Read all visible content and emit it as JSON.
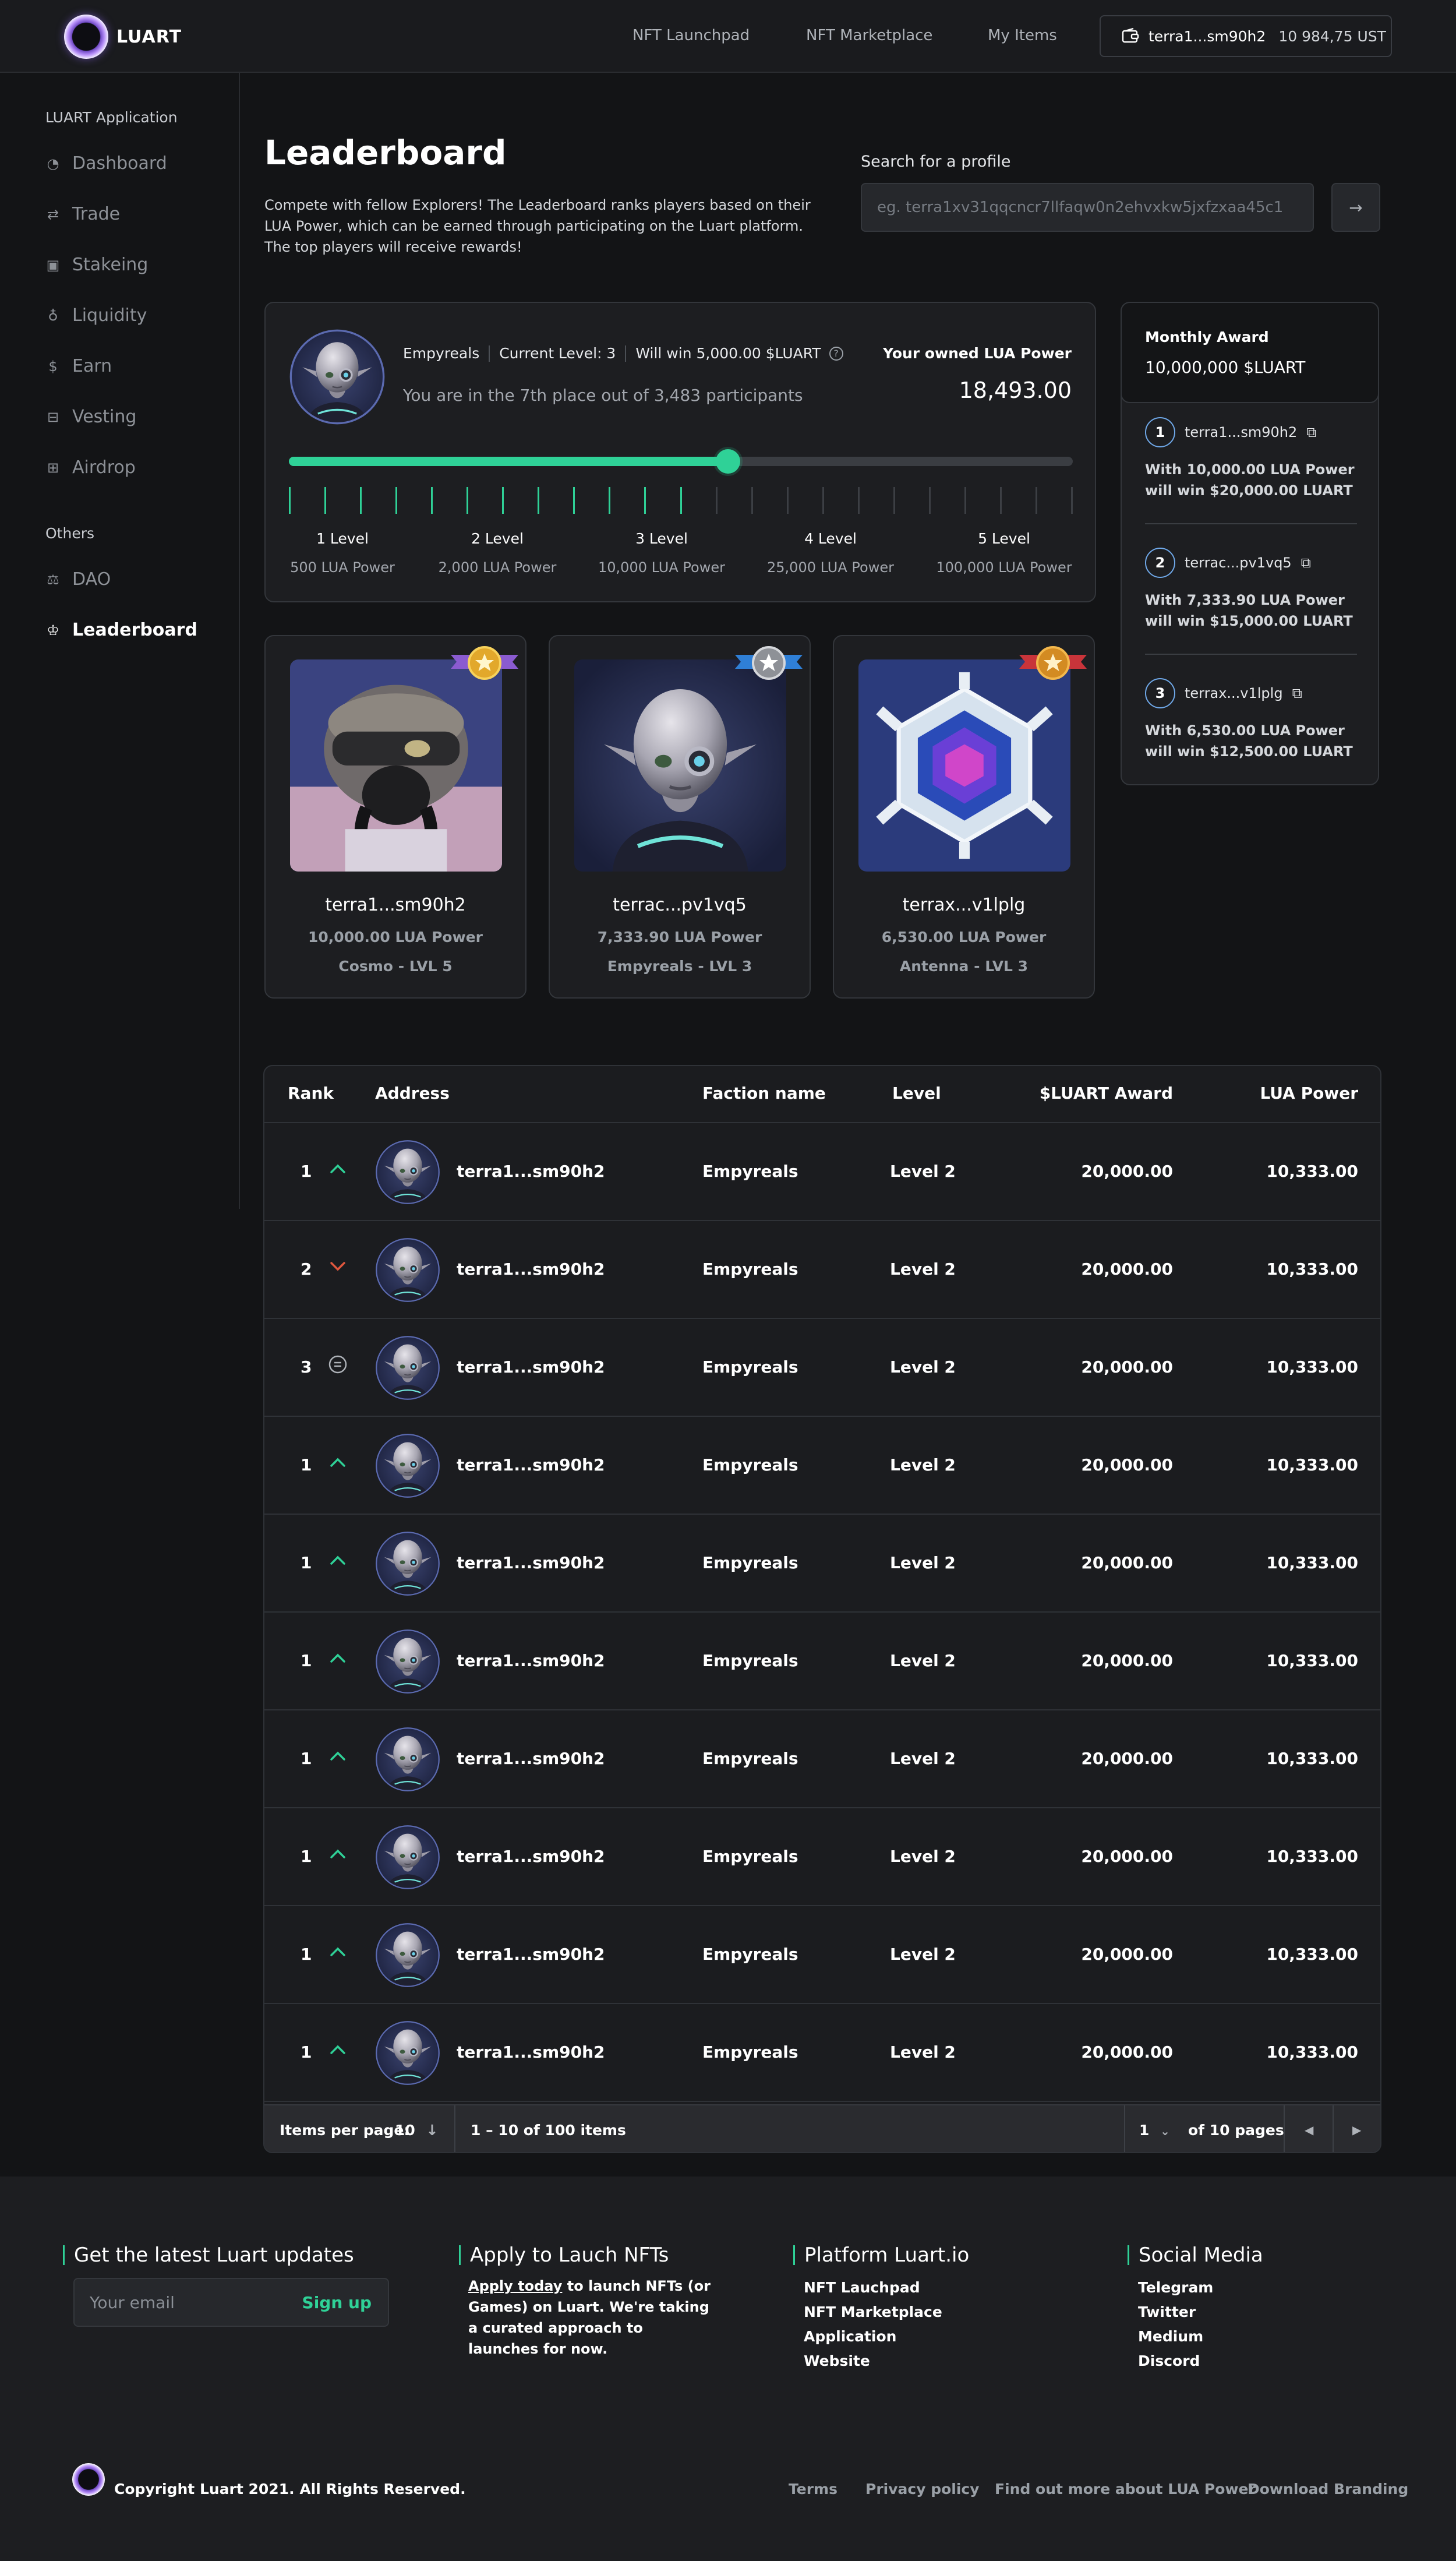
{
  "brand": {
    "name": "LUART"
  },
  "topnav": {
    "links": [
      "NFT Launchpad",
      "NFT Marketplace",
      "My Items"
    ],
    "wallet_address": "terra1...sm90h2",
    "wallet_balance": "10 984,75 UST"
  },
  "sidebar": {
    "section1": "LUART Application",
    "items1": [
      {
        "label": "Dashboard",
        "icon": "gauge-icon"
      },
      {
        "label": "Trade",
        "icon": "swap-icon"
      },
      {
        "label": "Stakeing",
        "icon": "stake-icon"
      },
      {
        "label": "Liquidity",
        "icon": "liquidity-icon"
      },
      {
        "label": "Earn",
        "icon": "dollar-icon"
      },
      {
        "label": "Vesting",
        "icon": "vesting-icon"
      },
      {
        "label": "Airdrop",
        "icon": "gift-icon"
      }
    ],
    "section2": "Others",
    "items2": [
      {
        "label": "DAO",
        "icon": "scale-icon"
      },
      {
        "label": "Leaderboard",
        "icon": "trophy-icon",
        "active": true
      }
    ]
  },
  "hero": {
    "title": "Leaderboard",
    "intro": "Compete with fellow Explorers! The Leaderboard ranks players based on their LUA Power, which can be earned through participating on the Luart platform. The top players will receive rewards!",
    "search_label": "Search for a profile",
    "search_placeholder": "eg. terra1xv31qqcncr7llfaqw0n2ehvxkw5jxfzxaa45c1"
  },
  "level_card": {
    "faction": "Empyreals",
    "current_level": "Current Level: 3",
    "will_win": "Will win 5,000.00 $LUART",
    "place_text": "You are in the 7th place out of 3,483 participants",
    "owned_label": "Your owned LUA Power",
    "owned_value": "18,493.00",
    "progress": 0.56,
    "ticks_total": 23,
    "ticks_active": 12,
    "levels": [
      {
        "name": "1 Level",
        "power": "500 LUA Power"
      },
      {
        "name": "2 Level",
        "power": "2,000 LUA Power"
      },
      {
        "name": "3 Level",
        "power": "10,000 LUA Power"
      },
      {
        "name": "4 Level",
        "power": "25,000 LUA Power"
      },
      {
        "name": "5 Level",
        "power": "100,000 LUA Power"
      }
    ]
  },
  "monthly_award": {
    "title": "Monthly Award",
    "value": "10,000,000 $LUART",
    "entries": [
      {
        "rank": "1",
        "address": "terra1...sm90h2",
        "line1": "With 10,000.00 LUA Power",
        "line2": "will win $20,000.00 LUART"
      },
      {
        "rank": "2",
        "address": "terrac...pv1vq5",
        "line1": "With 7,333.90 LUA Power",
        "line2": "will win $15,000.00 LUART"
      },
      {
        "rank": "3",
        "address": "terrax...v1lplg",
        "line1": "With 6,530.00 LUA Power",
        "line2": "will win $12,500.00 LUART"
      }
    ]
  },
  "top_players": [
    {
      "address": "terra1...sm90h2",
      "power": "10,000.00 LUA Power",
      "faction": "Cosmo - LVL 5",
      "medal": "gold"
    },
    {
      "address": "terrac...pv1vq5",
      "power": "7,333.90 LUA Power",
      "faction": "Empyreals - LVL 3",
      "medal": "silver"
    },
    {
      "address": "terrax...v1lplg",
      "power": "6,530.00 LUA Power",
      "faction": "Antenna - LVL 3",
      "medal": "bronze"
    }
  ],
  "table": {
    "headers": [
      "Rank",
      "Address",
      "Faction name",
      "Level",
      "$LUART Award",
      "LUA Power"
    ],
    "rows": [
      {
        "rank": "1",
        "trend": "up",
        "address": "terra1...sm90h2",
        "faction": "Empyreals",
        "level": "Level 2",
        "award": "20,000.00",
        "power": "10,333.00"
      },
      {
        "rank": "2",
        "trend": "down",
        "address": "terra1...sm90h2",
        "faction": "Empyreals",
        "level": "Level 2",
        "award": "20,000.00",
        "power": "10,333.00"
      },
      {
        "rank": "3",
        "trend": "same",
        "address": "terra1...sm90h2",
        "faction": "Empyreals",
        "level": "Level 2",
        "award": "20,000.00",
        "power": "10,333.00"
      },
      {
        "rank": "1",
        "trend": "up",
        "address": "terra1...sm90h2",
        "faction": "Empyreals",
        "level": "Level 2",
        "award": "20,000.00",
        "power": "10,333.00"
      },
      {
        "rank": "1",
        "trend": "up",
        "address": "terra1...sm90h2",
        "faction": "Empyreals",
        "level": "Level 2",
        "award": "20,000.00",
        "power": "10,333.00"
      },
      {
        "rank": "1",
        "trend": "up",
        "address": "terra1...sm90h2",
        "faction": "Empyreals",
        "level": "Level 2",
        "award": "20,000.00",
        "power": "10,333.00"
      },
      {
        "rank": "1",
        "trend": "up",
        "address": "terra1...sm90h2",
        "faction": "Empyreals",
        "level": "Level 2",
        "award": "20,000.00",
        "power": "10,333.00"
      },
      {
        "rank": "1",
        "trend": "up",
        "address": "terra1...sm90h2",
        "faction": "Empyreals",
        "level": "Level 2",
        "award": "20,000.00",
        "power": "10,333.00"
      },
      {
        "rank": "1",
        "trend": "up",
        "address": "terra1...sm90h2",
        "faction": "Empyreals",
        "level": "Level 2",
        "award": "20,000.00",
        "power": "10,333.00"
      },
      {
        "rank": "1",
        "trend": "up",
        "address": "terra1...sm90h2",
        "faction": "Empyreals",
        "level": "Level 2",
        "award": "20,000.00",
        "power": "10,333.00"
      }
    ],
    "footer": {
      "items_per_page_label": "Items per page:",
      "items_per_page_value": "10",
      "range": "1 – 10 of 100 items",
      "page_value": "1",
      "pages_text": "of 10 pages"
    }
  },
  "footer": {
    "updates_title": "Get the latest Luart updates",
    "email_placeholder": "Your email",
    "signup": "Sign up",
    "apply_title": "Apply to Lauch NFTs",
    "apply_link": "Apply today",
    "apply_text": " to launch NFTs (or Games) on Luart. We're taking a curated approach to launches for now.",
    "platform_title": "Platform Luart.io",
    "platform_links": [
      "NFT Lauchpad",
      "NFT Marketplace",
      "Application",
      "Website"
    ],
    "social_title": "Social Media",
    "social_links": [
      "Telegram",
      "Twitter",
      "Medium",
      "Discord"
    ],
    "copyright": "Copyright Luart 2021. All Rights Reserved.",
    "legal_links": [
      "Terms",
      "Privacy policy",
      "Find out more about LUA Power",
      "Download Branding"
    ]
  },
  "colors": {
    "accent": "#2fd197",
    "down": "#e0573e",
    "background": "#131416",
    "card": "#1d1e21"
  }
}
